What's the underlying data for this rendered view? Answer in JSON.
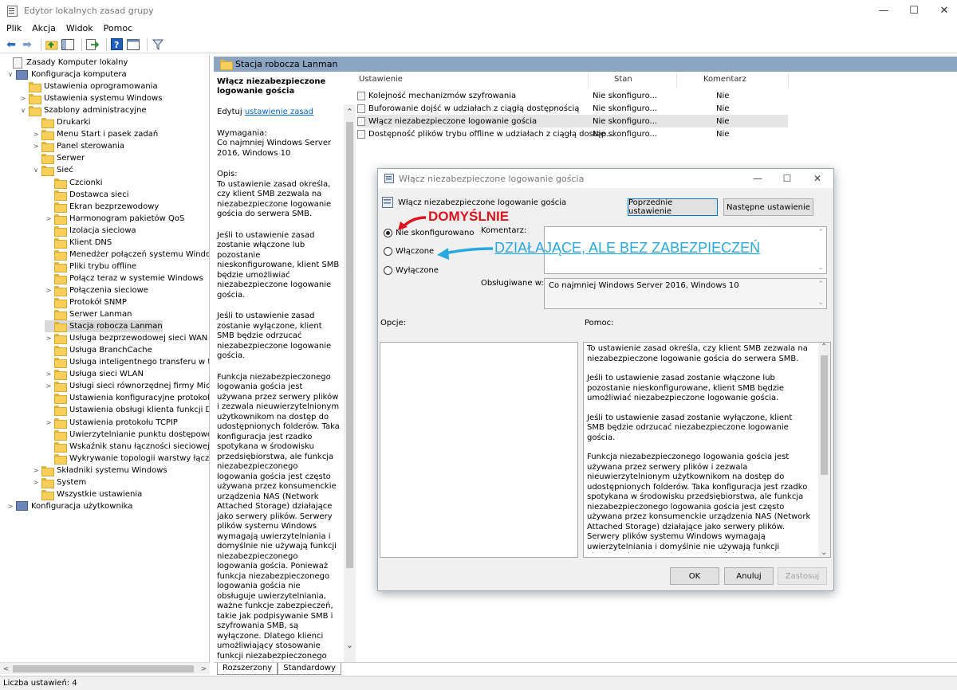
{
  "window": {
    "title": "Edytor lokalnych zasad grupy",
    "min": "—",
    "max": "☐",
    "close": "✕"
  },
  "menu": [
    "Plik",
    "Akcja",
    "Widok",
    "Pomoc"
  ],
  "tree": {
    "items": [
      {
        "label": "Zasady Komputer lokalny",
        "indent": 0,
        "exp": "",
        "icon": "policy"
      },
      {
        "label": "Konfiguracja komputera",
        "indent": 1,
        "exp": "∨",
        "icon": "computer"
      },
      {
        "label": "Ustawienia oprogramowania",
        "indent": 2,
        "exp": "",
        "icon": "folder"
      },
      {
        "label": "Ustawienia systemu Windows",
        "indent": 2,
        "exp": ">",
        "icon": "folder"
      },
      {
        "label": "Szablony administracyjne",
        "indent": 2,
        "exp": "∨",
        "icon": "folder"
      },
      {
        "label": "Drukarki",
        "indent": 3,
        "exp": "",
        "icon": "folder"
      },
      {
        "label": "Menu Start i pasek zadań",
        "indent": 3,
        "exp": ">",
        "icon": "folder"
      },
      {
        "label": "Panel sterowania",
        "indent": 3,
        "exp": ">",
        "icon": "folder"
      },
      {
        "label": "Serwer",
        "indent": 3,
        "exp": "",
        "icon": "folder"
      },
      {
        "label": "Sieć",
        "indent": 3,
        "exp": "∨",
        "icon": "folder"
      },
      {
        "label": "Czcionki",
        "indent": 4,
        "exp": "",
        "icon": "folder"
      },
      {
        "label": "Dostawca sieci",
        "indent": 4,
        "exp": "",
        "icon": "folder"
      },
      {
        "label": "Ekran bezprzewodowy",
        "indent": 4,
        "exp": "",
        "icon": "folder"
      },
      {
        "label": "Harmonogram pakietów QoS",
        "indent": 4,
        "exp": ">",
        "icon": "folder"
      },
      {
        "label": "Izolacja sieciowa",
        "indent": 4,
        "exp": "",
        "icon": "folder"
      },
      {
        "label": "Klient DNS",
        "indent": 4,
        "exp": "",
        "icon": "folder"
      },
      {
        "label": "Menedżer połączeń systemu Windows",
        "indent": 4,
        "exp": "",
        "icon": "folder"
      },
      {
        "label": "Pliki trybu offline",
        "indent": 4,
        "exp": "",
        "icon": "folder"
      },
      {
        "label": "Połącz teraz w systemie Windows",
        "indent": 4,
        "exp": "",
        "icon": "folder"
      },
      {
        "label": "Połączenia sieciowe",
        "indent": 4,
        "exp": ">",
        "icon": "folder"
      },
      {
        "label": "Protokół SNMP",
        "indent": 4,
        "exp": "",
        "icon": "folder"
      },
      {
        "label": "Serwer Lanman",
        "indent": 4,
        "exp": "",
        "icon": "folder"
      },
      {
        "label": "Stacja robocza Lanman",
        "indent": 4,
        "exp": "",
        "icon": "folder",
        "selected": true
      },
      {
        "label": "Usługa bezprzewodowej sieci WAN",
        "indent": 4,
        "exp": ">",
        "icon": "folder"
      },
      {
        "label": "Usługa BranchCache",
        "indent": 4,
        "exp": "",
        "icon": "folder"
      },
      {
        "label": "Usługa inteligentnego transferu w tle (B",
        "indent": 4,
        "exp": "",
        "icon": "folder"
      },
      {
        "label": "Usługa sieci WLAN",
        "indent": 4,
        "exp": ">",
        "icon": "folder"
      },
      {
        "label": "Usługi sieci równorzędnej firmy Microso",
        "indent": 4,
        "exp": ">",
        "icon": "folder"
      },
      {
        "label": "Ustawienia konfiguracyjne protokołu SS",
        "indent": 4,
        "exp": "",
        "icon": "folder"
      },
      {
        "label": "Ustawienia obsługi klienta funkcji Direct",
        "indent": 4,
        "exp": "",
        "icon": "folder"
      },
      {
        "label": "Ustawienia protokołu TCPIP",
        "indent": 4,
        "exp": ">",
        "icon": "folder"
      },
      {
        "label": "Uwierzytelnianie punktu dostępowego c",
        "indent": 4,
        "exp": "",
        "icon": "folder"
      },
      {
        "label": "Wskaźnik stanu łączności sieciowej",
        "indent": 4,
        "exp": "",
        "icon": "folder"
      },
      {
        "label": "Wykrywanie topologii warstwy łączy",
        "indent": 4,
        "exp": "",
        "icon": "folder"
      },
      {
        "label": "Składniki systemu Windows",
        "indent": 3,
        "exp": ">",
        "icon": "folder"
      },
      {
        "label": "System",
        "indent": 3,
        "exp": ">",
        "icon": "folder"
      },
      {
        "label": "Wszystkie ustawienia",
        "indent": 3,
        "exp": "",
        "icon": "folder"
      },
      {
        "label": "Konfiguracja użytkownika",
        "indent": 1,
        "exp": ">",
        "icon": "computer"
      }
    ]
  },
  "right_header": "Stacja robocza Lanman",
  "description": {
    "title": "Włącz niezabezpieczone logowanie gościa",
    "edit_prefix": "Edytuj ",
    "edit_link": "ustawienie zasad ",
    "requirements": "Wymagania:\nCo najmniej Windows Server 2016, Windows 10",
    "opis": "Opis:\nTo ustawienie zasad określa, czy klient SMB zezwala na niezabezpieczone logowanie gościa do serwera SMB.",
    "p1": "Jeśli to ustawienie zasad zostanie włączone lub pozostanie nieskonfigurowane, klient SMB będzie umożliwiać niezabezpieczone logowanie gościa.",
    "p2": "Jeśli to ustawienie zasad zostanie wyłączone, klient SMB będzie odrzucać niezabezpieczone logowanie gościa.",
    "p3": "Funkcja niezabezpieczonego logowania gościa jest używana przez serwery plików i zezwala nieuwierzytelnionym użytkownikom na dostęp do udostępnionych folderów. Taka konfiguracja jest rzadko spotykana w środowisku przedsiębiorstwa, ale funkcja niezabezpieczonego logowania gościa jest często używana przez konsumenckie urządzenia NAS (Network Attached Storage) działające jako serwery plików. Serwery plików systemu Windows wymagają uwierzytelniania i domyślnie nie używają funkcji niezabezpieczonego logowania gościa. Ponieważ funkcja niezabezpieczonego logowania gościa nie obsługuje uwierzytelniania, ważne funkcje zabezpieczeń, takie jak podpisywanie SMB i szyfrowania SMB, są wyłączone. Dlatego klienci umożliwiający stosowanie funkcji niezabezpieczonego logowania gościa są podatni na różne ataki typu man-in-the-middle, które mogą spowodować utratę danych, uszkodzenie danych i ich narażenie na"
  },
  "list": {
    "headers": {
      "setting": "Ustawienie",
      "state": "Stan",
      "comment": "Komentarz"
    },
    "rows": [
      {
        "name": "Kolejność mechanizmów szyfrowania",
        "state": "Nie skonfiguro...",
        "comment": "Nie"
      },
      {
        "name": "Buforowanie dojść w udziałach z ciągłą dostępnością",
        "state": "Nie skonfiguro...",
        "comment": "Nie"
      },
      {
        "name": "Włącz niezabezpieczone logowanie gościa",
        "state": "Nie skonfiguro...",
        "comment": "Nie",
        "selected": true
      },
      {
        "name": "Dostępność plików trybu offline w udziałach z ciągłą dostęp...",
        "state": "Nie skonfiguro...",
        "comment": "Nie"
      }
    ]
  },
  "tabs": [
    "Rozszerzony",
    "Standardowy"
  ],
  "status": "Liczba ustawień: 4",
  "dialog": {
    "title": "Włącz niezabezpieczone logowanie gościa",
    "setting_name": "Włącz niezabezpieczone logowanie gościa",
    "prev_button": "Poprzednie ustawienie",
    "next_button": "Następne ustawienie",
    "radio_not_configured": "Nie skonfigurowano",
    "radio_enabled": "Włączone",
    "radio_disabled": "Wyłączone",
    "comment_label": "Komentarz:",
    "supported_label": "Obsługiwane w:",
    "supported_value": "Co najmniej Windows Server 2016, Windows 10",
    "options_label": "Opcje:",
    "help_label": "Pomoc:",
    "help_p1": "To ustawienie zasad określa, czy klient SMB zezwala na niezabezpieczone logowanie gościa do serwera SMB.",
    "help_p2": "Jeśli to ustawienie zasad zostanie włączone lub pozostanie nieskonfigurowane, klient SMB będzie umożliwiać niezabezpieczone logowanie gościa.",
    "help_p3": "Jeśli to ustawienie zasad zostanie wyłączone, klient SMB będzie odrzucać niezabezpieczone logowanie gościa.",
    "help_p4": "Funkcja niezabezpieczonego logowania gościa jest używana przez serwery plików i zezwala nieuwierzytelnionym użytkownikom na dostęp do udostępnionych folderów. Taka konfiguracja jest rzadko spotykana w środowisku przedsiębiorstwa, ale funkcja niezabezpieczonego logowania gościa jest często używana przez konsumenckie urządzenia NAS (Network Attached Storage) działające jako serwery plików. Serwery plików systemu Windows wymagają uwierzytelniania i domyślnie nie używają funkcji niezabezpieczonego logowania gościa. Ponieważ funkcja niezabezpieczonego logowania gościa nie obsługuje uwierzytelniania, ważne funkcje zabezpieczeń, takie jak podpisywanie SMB i szyfrowania SMB, są wyłączone.",
    "ok": "OK",
    "cancel": "Anuluj",
    "apply": "Zastosuj"
  },
  "annotations": {
    "default": "DOMYŚLNIE",
    "enabled_note": "DZIAŁAJĄCE, ALE BEZ ZABEZPIECZEŃ",
    "red": "#e0121d",
    "blue": "#29a8e0"
  }
}
